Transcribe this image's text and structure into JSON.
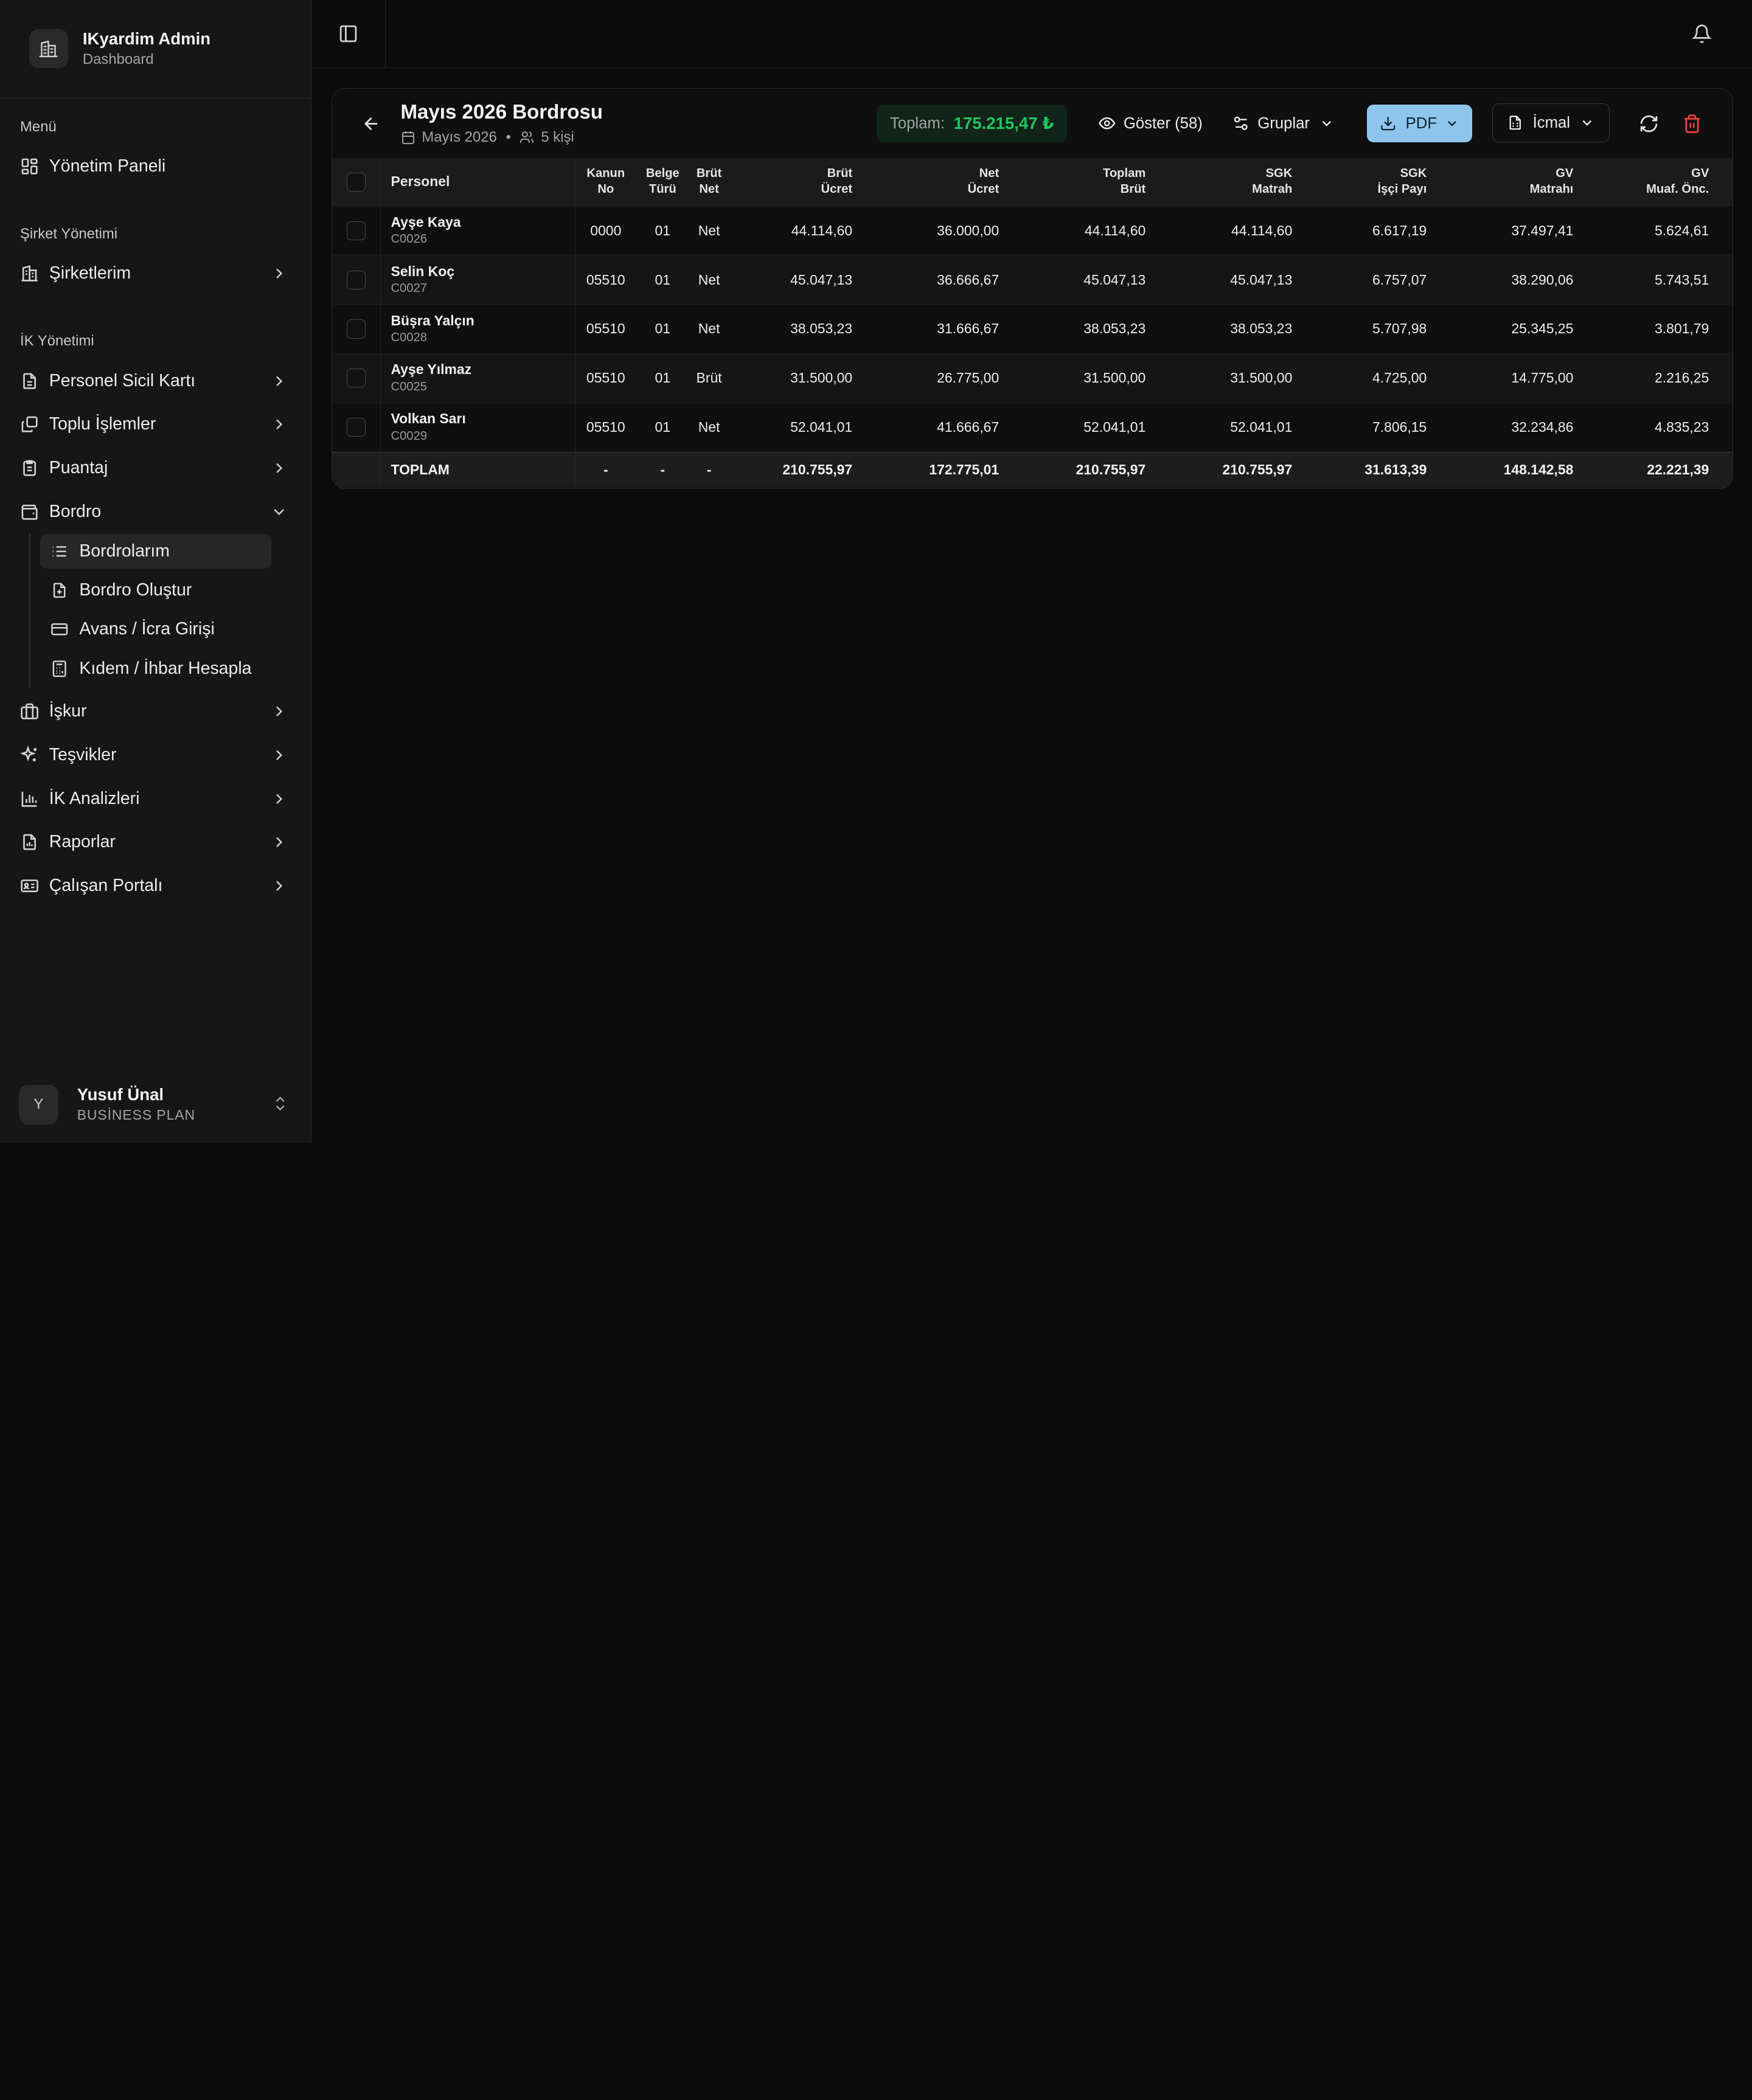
{
  "brand": {
    "title": "IKyardim Admin",
    "subtitle": "Dashboard"
  },
  "sidebar": {
    "sections": {
      "menu": "Menü",
      "company": "Şirket Yönetimi",
      "hr": "İK Yönetimi"
    },
    "items": {
      "dashboard": "Yönetim Paneli",
      "companies": "Şirketlerim",
      "personnel": "Personel Sicil Kartı",
      "bulk": "Toplu İşlemler",
      "puantaj": "Puantaj",
      "bordro": "Bordro",
      "iskur": "İşkur",
      "incentives": "Teşvikler",
      "analytics": "İK Analizleri",
      "reports": "Raporlar",
      "portal": "Çalışan Portalı"
    },
    "bordro_sub": {
      "mine": "Bordrolarım",
      "create": "Bordro Oluştur",
      "advance": "Avans / İcra Girişi",
      "severance": "Kıdem / İhbar Hesapla"
    },
    "user": {
      "initial": "Y",
      "name": "Yusuf Ünal",
      "plan": "BUSİNESS PLAN"
    }
  },
  "payroll": {
    "title": "Mayıs 2026 Bordrosu",
    "period": "Mayıs 2026",
    "separator": "•",
    "people": "5 kişi",
    "total_label": "Toplam:",
    "total_value": "175.215,47 ₺",
    "show_label": "Göster (58)",
    "groups_label": "Gruplar",
    "pdf_label": "PDF",
    "icmal_label": "İcmal"
  },
  "table": {
    "headers": {
      "personel": "Personel",
      "kanun": "Kanun\nNo",
      "belge": "Belge\nTürü",
      "brut_net": "Brüt\nNet",
      "brut_ucret": "Brüt\nÜcret",
      "net_ucret": "Net\nÜcret",
      "toplam_brut": "Toplam\nBrüt",
      "sgk_matrah": "SGK\nMatrah",
      "sgk_isci": "SGK\nİşçi Payı",
      "gv_matrah": "GV\nMatrahı",
      "gv_muaf": "GV\nMuaf. Önc."
    },
    "rows": [
      {
        "name": "Ayşe Kaya",
        "code": "C0026",
        "kanun": "0000",
        "belge": "01",
        "type": "Net",
        "brut": "44.114,60",
        "net": "36.000,00",
        "toplam": "44.114,60",
        "sgk_m": "44.114,60",
        "sgk_i": "6.617,19",
        "gv_m": "37.497,41",
        "gv_o": "5.624,61"
      },
      {
        "name": "Selin Koç",
        "code": "C0027",
        "kanun": "05510",
        "belge": "01",
        "type": "Net",
        "brut": "45.047,13",
        "net": "36.666,67",
        "toplam": "45.047,13",
        "sgk_m": "45.047,13",
        "sgk_i": "6.757,07",
        "gv_m": "38.290,06",
        "gv_o": "5.743,51"
      },
      {
        "name": "Büşra Yalçın",
        "code": "C0028",
        "kanun": "05510",
        "belge": "01",
        "type": "Net",
        "brut": "38.053,23",
        "net": "31.666,67",
        "toplam": "38.053,23",
        "sgk_m": "38.053,23",
        "sgk_i": "5.707,98",
        "gv_m": "25.345,25",
        "gv_o": "3.801,79"
      },
      {
        "name": "Ayşe Yılmaz",
        "code": "C0025",
        "kanun": "05510",
        "belge": "01",
        "type": "Brüt",
        "brut": "31.500,00",
        "net": "26.775,00",
        "toplam": "31.500,00",
        "sgk_m": "31.500,00",
        "sgk_i": "4.725,00",
        "gv_m": "14.775,00",
        "gv_o": "2.216,25"
      },
      {
        "name": "Volkan Sarı",
        "code": "C0029",
        "kanun": "05510",
        "belge": "01",
        "type": "Net",
        "brut": "52.041,01",
        "net": "41.666,67",
        "toplam": "52.041,01",
        "sgk_m": "52.041,01",
        "sgk_i": "7.806,15",
        "gv_m": "32.234,86",
        "gv_o": "4.835,23"
      }
    ],
    "total": {
      "label": "TOPLAM",
      "kanun": "-",
      "belge": "-",
      "type": "-",
      "brut": "210.755,97",
      "net": "172.775,01",
      "toplam": "210.755,97",
      "sgk_m": "210.755,97",
      "sgk_i": "31.613,39",
      "gv_m": "148.142,58",
      "gv_o": "22.221,39"
    }
  },
  "colors": {
    "accent_green": "#22c55e",
    "pdf_button": "#8ec5ec",
    "delete_red": "#ef4444"
  }
}
